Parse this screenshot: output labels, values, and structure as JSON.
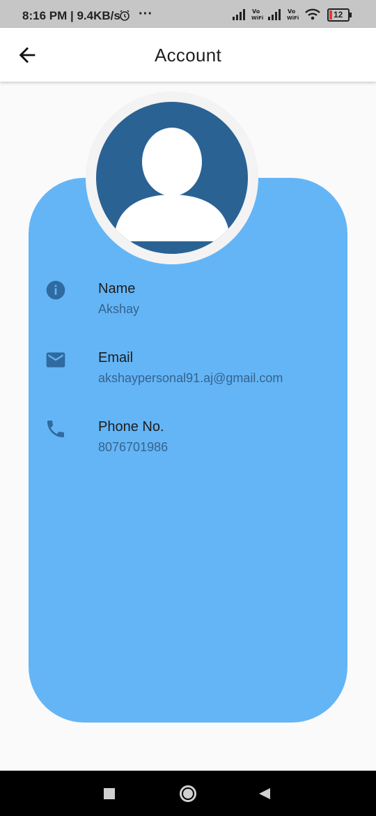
{
  "status_bar": {
    "time": "8:16 PM | 9.4KB/s",
    "more": "···",
    "battery": "12",
    "network_label": "Vo WiFi"
  },
  "app_bar": {
    "title": "Account",
    "back_icon": "arrow-back-icon"
  },
  "profile": {
    "avatar_icon": "person-icon",
    "fields": [
      {
        "label": "Name",
        "value": "Akshay",
        "icon": "info-icon"
      },
      {
        "label": "Email",
        "value": "akshaypersonal91.aj@gmail.com",
        "icon": "mail-icon"
      },
      {
        "label": "Phone No.",
        "value": "8076701986",
        "icon": "phone-icon"
      }
    ]
  },
  "nav_bar": {
    "items": [
      "recents-square-icon",
      "home-circle-icon",
      "back-triangle-icon"
    ]
  },
  "colors": {
    "card": "#64b5f6",
    "avatar": "#2a6294",
    "icon": "#2f6aa0"
  }
}
